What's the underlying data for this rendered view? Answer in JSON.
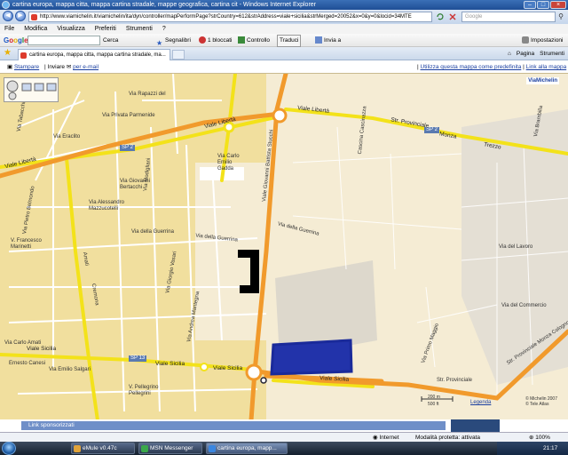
{
  "window": {
    "title": "cartina europa, mappa citta, mappa cartina stradale, mappe geografica, cartina cit - Windows Internet Explorer",
    "minimize": "–",
    "maximize": "□",
    "close": "×"
  },
  "address_bar": {
    "back": "◀",
    "forward": "▶",
    "url": "http://www.viamichelin.it/viamichelin/ita/dyn/controller/mapPerformPage?strCountry=612&strAddress=viale+sicilia&strMerged=20052&x=0&y=0&locid=34MTE",
    "search_placeholder": "Google",
    "search_go": "⚲"
  },
  "menu": [
    "File",
    "Modifica",
    "Visualizza",
    "Preferiti",
    "Strumenti",
    "?"
  ],
  "google_toolbar": {
    "logo": [
      "G",
      "o",
      "o",
      "g",
      "l",
      "e"
    ],
    "cerca": "Cerca",
    "segnalibri": "Segnalibri",
    "bloccati": "1 bloccati",
    "controllo": "Controllo",
    "traduci": "Traduci",
    "invia": "Invia a",
    "impostazioni": "Impostazioni"
  },
  "tabs": {
    "active": "cartina europa, mappa citta, mappa cartina stradale, ma...",
    "cmd_home": "⌂",
    "cmd_pagina": "Pagina",
    "cmd_strumenti": "Strumenti"
  },
  "page_header": {
    "stampare": "Stampare",
    "separator": "|",
    "inviare": "Inviare",
    "per_email": "per e-mail",
    "link_predefinita": "Utilizza questa mappa come predefinita",
    "link_alla_mappa": "Link alla mappa"
  },
  "map": {
    "viamichelin_logo": "ViaMichelin",
    "labels": {
      "viale_liberta_left": "Viale Libertà",
      "viale_liberta_mid": "Viale Libertà",
      "viale_liberta_right": "Viale Libertà",
      "sp2_left": "SP 2",
      "sp2_right": "SP 2",
      "str_provinciale": "Str. Provinciale",
      "monza": "Monza",
      "trezzo": "Trezzo",
      "via_rapazzi": "Via Rapazzi del",
      "via_borgazzi": "Viale Borgazzi",
      "via_privata_parmenide": "Via Privata Parmenide",
      "via_eraclito": "Via Eraclito",
      "via_pietro_belmondo": "Via Pietro Belmondo",
      "via_carlo_emilio_gadda": "Via Carlo Emilio Gadda",
      "via_giovanni_bertacchi": "Via Giovanni Bertacchi",
      "via_alessandro_mazzucotelli": "Via Alessandro Mazzucotelli",
      "via_della_guerrina": "Via della Guerrina",
      "via_della_guerrina2": "Via della Guerrina",
      "viale_sicilia_left": "Viale Sicilia",
      "viale_sicilia_mid": "Viale Sicilia",
      "viale_sicilia_right": "Viale Sicilia",
      "sp13": "SP 13",
      "via_carlo_amati": "Via Carlo Amati",
      "via_ernesto_canesi": "Ernesto Canesi",
      "via_emilio_salgari": "Via Emilio Salgari",
      "via_francesco_marinetti": "V. Francesco Marinetti",
      "via_amati": "Amati",
      "via_cremona": "Cremona",
      "via_giorgio_vasari": "Via Giorgio Vasari",
      "via_andrea_mantegna": "Via Andrea Mantegna",
      "via_pellegrino_pellegrini": "V. Pellegrino Pellegrini",
      "via_giovanni_battista": "Viale Giovanni Battista Stucchi",
      "via_nazaro_sauro": "Via Nazario Sauro",
      "via_dolomiti": "Via Dolomiti",
      "via_modigliani": "Via Modigliani",
      "via_goya": "Via Goya",
      "via_del_lavoro": "Via del Lavoro",
      "via_del_commercio": "Via del Commercio",
      "via_primo_maggio": "Via Primo Maggio",
      "str_provinciale_bottom": "Str. Provinciale",
      "str_prov_monza": "Str. Provinciale Monza Cologno",
      "via_brambilla": "Via Brambilla",
      "cascina_cascinazza": "Cascina Cascinazza",
      "via_tabacchi": "Via Tabacchi",
      "via_monte_grappa": "Via Monte Grappa",
      "via_rossini": "Rossini"
    },
    "copyright": "© Michelin 2007\n© Tele Atlas",
    "scale_m": "200 m",
    "scale_ft": "500 ft",
    "legenda": "Legenda"
  },
  "sponsor": {
    "label": "Link sponsorizzati"
  },
  "status": {
    "internet": "Internet",
    "protetta": "Modalità protetta: attivata",
    "zoom": "100%"
  },
  "taskbar": {
    "items": [
      "eMule v0.47c",
      "MSN Messenger",
      "cartina europa, mapp..."
    ],
    "clock": "21:17"
  }
}
